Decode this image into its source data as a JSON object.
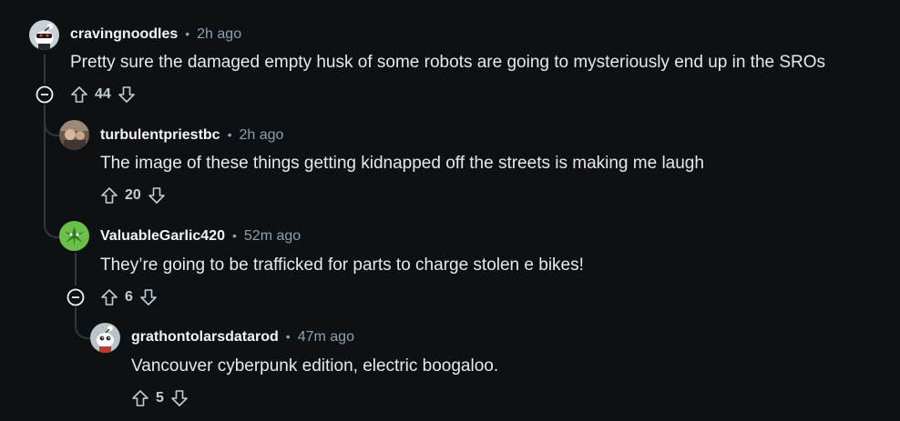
{
  "comments": [
    {
      "author": "cravingnoodles",
      "time": "2h ago",
      "body": "Pretty sure the damaged empty husk of some robots are going to mysteriously end up in the SROs",
      "score": "44",
      "avatar_icon": "snoo-avatar-icon"
    },
    {
      "author": "turbulentpriestbc",
      "time": "2h ago",
      "body": "The image of these things getting kidnapped off the streets is making me laugh",
      "score": "20",
      "avatar_icon": "photo-avatar-icon"
    },
    {
      "author": "ValuableGarlic420",
      "time": "52m ago",
      "body": "They’re going to be trafficked for parts to charge stolen e bikes!",
      "score": "6",
      "avatar_icon": "leaf-avatar-icon"
    },
    {
      "author": "grathontolarsdatarod",
      "time": "47m ago",
      "body": "Vancouver cyberpunk edition, electric boogaloo.",
      "score": "5",
      "avatar_icon": "snoo-avatar-icon"
    }
  ],
  "separator": "•",
  "colors": {
    "background": "#0e1113",
    "thread_line": "#33383c",
    "text": "#e6e9ea",
    "meta": "#8ba2ad"
  }
}
